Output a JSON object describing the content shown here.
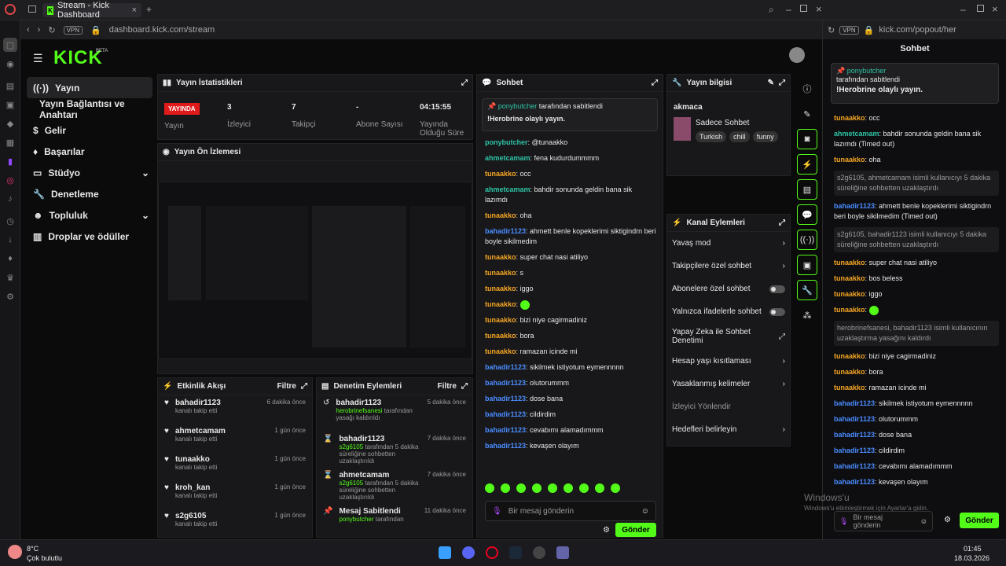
{
  "browser": {
    "tab_title": "Stream - Kick Dashboard",
    "url": "dashboard.kick.com/stream",
    "popout_url": "kick.com/popout/her",
    "vpn": "VPN"
  },
  "logo": "KICK",
  "logo_sup": "BETA",
  "nav": [
    "Yayın",
    "Yayın Bağlantısı ve Anahtarı",
    "Gelir",
    "Başarılar",
    "Stüdyo",
    "Denetleme",
    "Topluluk",
    "Droplar ve ödüller"
  ],
  "stats": {
    "title": "Yayın İstatistikleri",
    "live": "YAYINDA",
    "live_label": "Yayın",
    "items": [
      {
        "v": "3",
        "l": "İzleyici"
      },
      {
        "v": "7",
        "l": "Takipçi"
      },
      {
        "v": "-",
        "l": "Abone Sayısı"
      },
      {
        "v": "04:15:55",
        "l": "Yayında Olduğu Süre"
      }
    ]
  },
  "preview": {
    "title": "Yayın Ön İzlemesi"
  },
  "activity": {
    "title": "Etkinlik Akışı",
    "filter": "Filtre",
    "items": [
      {
        "n": "bahadir1123",
        "s": "kanalı takip etti",
        "t": "6 dakika önce"
      },
      {
        "n": "ahmetcamam",
        "s": "kanalı takip etti",
        "t": "1 gün önce"
      },
      {
        "n": "tunaakko",
        "s": "kanalı takip etti",
        "t": "1 gün önce"
      },
      {
        "n": "kroh_kan",
        "s": "kanalı takip etti",
        "t": "1 gün önce"
      },
      {
        "n": "s2g6105",
        "s": "kanalı takip etti",
        "t": "1 gün önce"
      }
    ]
  },
  "mod": {
    "title": "Denetim Eylemleri",
    "filter": "Filtre",
    "items": [
      {
        "n": "bahadir1123",
        "u": "herobrinefsanesi",
        "s": "tarafından yasağı kaldırıldı",
        "t": "5 dakika önce"
      },
      {
        "n": "bahadir1123",
        "u": "s2g6105",
        "s": "tarafından 5 dakika süreliğine sohbetten uzaklaştırıldı",
        "t": "7 dakika önce"
      },
      {
        "n": "ahmetcamam",
        "u": "s2g6105",
        "s": "tarafından 5 dakika süreliğine sohbetten uzaklaştırıldı",
        "t": "7 dakika önce"
      },
      {
        "n": "Mesaj Sabitlendi",
        "u": "ponybutcher",
        "s": "tarafından",
        "t": "11 dakika önce"
      }
    ]
  },
  "chat": {
    "title": "Sohbet",
    "pin_user": "ponybutcher",
    "pin_by": "tarafından sabitlendi",
    "pin_msg": "!Herobrine olaylı yayın.",
    "placeholder": "Bir mesaj gönderin",
    "send": "Gönder",
    "tooltip": "tunaakko",
    "lines": [
      {
        "u": "ponybutcher",
        "c": "c",
        "m": "@tunaakko"
      },
      {
        "u": "ahmetcamam",
        "c": "c",
        "m": "fena kudurdummmm"
      },
      {
        "u": "tunaakko",
        "c": "t",
        "m": "occ"
      },
      {
        "u": "ahmetcamam",
        "c": "c",
        "m": "bahdir sonunda geldin bana sik lazımdı"
      },
      {
        "u": "tunaakko",
        "c": "t",
        "m": "oha"
      },
      {
        "u": "bahadir1123",
        "c": "b",
        "m": "ahmett benle kopeklerimi siktigindrn beri boyle sikilmedim"
      },
      {
        "u": "tunaakko",
        "c": "t",
        "m": "super chat nasi atiliyo"
      },
      {
        "u": "tunaakko",
        "c": "t",
        "m": "s"
      },
      {
        "u": "tunaakko",
        "c": "t",
        "m": "iggo"
      },
      {
        "u": "tunaakko",
        "c": "t",
        "m": ""
      },
      {
        "u": "tunaakko",
        "c": "t",
        "m": "bizi niye cagirmadiniz"
      },
      {
        "u": "tunaakko",
        "c": "t",
        "m": "bora"
      },
      {
        "u": "tunaakko",
        "c": "t",
        "m": "ramazan icinde mi"
      },
      {
        "u": "bahadir1123",
        "c": "b",
        "m": "sikilmek istiyotum eymennnnn"
      },
      {
        "u": "bahadir1123",
        "c": "b",
        "m": "olutorummm"
      },
      {
        "u": "bahadir1123",
        "c": "b",
        "m": "dose bana"
      },
      {
        "u": "bahadir1123",
        "c": "b",
        "m": "cildirdim"
      },
      {
        "u": "bahadir1123",
        "c": "b",
        "m": "cevabımı alamadımmm"
      },
      {
        "u": "bahadir1123",
        "c": "b",
        "m": "kevaşen olayım"
      }
    ]
  },
  "info": {
    "title": "Yayın bilgisi",
    "channel": "akmaca",
    "category": "Sadece Sohbet",
    "tags": [
      "Turkish",
      "chill",
      "funny"
    ]
  },
  "actions": {
    "title": "Kanal Eylemleri",
    "items": [
      "Yavaş mod",
      "Takipçilere özel sohbet",
      "Abonelere özel sohbet",
      "Yalnızca ifadelerle sohbet",
      "Yapay Zeka ile Sohbet Denetimi",
      "Hesap yaşı kısıtlaması",
      "Yasaklanmış kelimeler",
      "İzleyici Yönlendir",
      "Hedefleri belirleyin"
    ]
  },
  "popout": {
    "title": "Sohbet",
    "pin_user": "ponybutcher",
    "pin_by": "tarafından sabitlendi",
    "pin_msg": "!Herobrine olaylı yayın.",
    "placeholder": "Bir mesaj gönderin",
    "send": "Gönder",
    "lines": [
      {
        "u": "tunaakko",
        "c": "t",
        "m": "occ"
      },
      {
        "u": "ahmetcamam",
        "c": "c",
        "m": "bahdir sonunda geldin bana sik lazımdı (Timed out)"
      },
      {
        "u": "tunaakko",
        "c": "t",
        "m": "oha"
      },
      {
        "u": "",
        "c": "",
        "m": "s2g6105, ahmetcamam isimli kullanıcıyı 5 dakika süreliğine sohbetten uzaklaştırdı"
      },
      {
        "u": "bahadir1123",
        "c": "b",
        "m": "ahmett benle kopeklerimi siktigindrn beri boyle sikilmedim (Timed out)"
      },
      {
        "u": "",
        "c": "",
        "m": "s2g6105, bahadir1123 isimli kullanıcıyı 5 dakika süreliğine sohbetten uzaklaştırdı"
      },
      {
        "u": "tunaakko",
        "c": "t",
        "m": "super chat nasi atiliyo"
      },
      {
        "u": "tunaakko",
        "c": "t",
        "m": "bos beless"
      },
      {
        "u": "tunaakko",
        "c": "t",
        "m": "iggo"
      },
      {
        "u": "tunaakko",
        "c": "t",
        "m": ""
      },
      {
        "u": "",
        "c": "",
        "m": "herobrinefsanesi, bahadir1123 isimli kullanıcının uzaklaştırma yasağını kaldırdı"
      },
      {
        "u": "tunaakko",
        "c": "t",
        "m": "bizi niye cagirmadiniz"
      },
      {
        "u": "tunaakko",
        "c": "t",
        "m": "bora"
      },
      {
        "u": "tunaakko",
        "c": "t",
        "m": "ramazan icinde mi"
      },
      {
        "u": "bahadir1123",
        "c": "b",
        "m": "sikilmek istiyotum eymennnnn"
      },
      {
        "u": "bahadir1123",
        "c": "b",
        "m": "olutorummm"
      },
      {
        "u": "bahadir1123",
        "c": "b",
        "m": "dose bana"
      },
      {
        "u": "bahadir1123",
        "c": "b",
        "m": "cildirdim"
      },
      {
        "u": "bahadir1123",
        "c": "b",
        "m": "cevabımı alamadımmm"
      },
      {
        "u": "bahadir1123",
        "c": "b",
        "m": "kevaşen olayım"
      }
    ]
  },
  "watermark": {
    "l1": "Windows'u",
    "l2": "Windows'u etkinleştirmek için Ayarlar'a gidin."
  },
  "taskbar": {
    "temp": "8°C",
    "weather": "Çok bulutlu",
    "time": "01:45",
    "date": "18.03.2026"
  }
}
